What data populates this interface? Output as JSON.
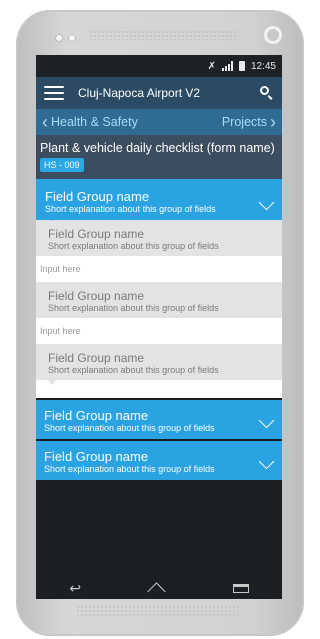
{
  "status": {
    "time": "12:45"
  },
  "appbar": {
    "title": "Cluj-Napoca Airport V2"
  },
  "subnav": {
    "back_label": "Health & Safety",
    "forward_label": "Projects"
  },
  "form": {
    "name": "Plant & vehicle daily checklist (form name)",
    "code": "HS - 009"
  },
  "groups": [
    {
      "title": "Field Group name",
      "subtitle": "Short explanation about this group of fields",
      "expanded": true,
      "items": [
        {
          "title": "Field Group name",
          "subtitle": "Short explanation about this group of fields",
          "input_placeholder": "Input here"
        },
        {
          "title": "Field Group name",
          "subtitle": "Short explanation about this group of fields",
          "input_placeholder": "Input here"
        },
        {
          "title": "Field Group name",
          "subtitle": "Short explanation about this group of fields"
        }
      ]
    },
    {
      "title": "Field Group name",
      "subtitle": "Short explanation about this group of fields",
      "expanded": false
    },
    {
      "title": "Field Group name",
      "subtitle": "Short explanation about this group of fields",
      "expanded": false
    }
  ],
  "colors": {
    "appbar": "#2b4a63",
    "subnav": "#2f6b93",
    "accent": "#2aa3e2",
    "formhead": "#3b4d5e"
  },
  "icons": [
    "menu-icon",
    "search-icon",
    "chevron-left-icon",
    "chevron-right-icon",
    "chevron-down-icon",
    "back-nav-icon",
    "home-nav-icon",
    "recent-apps-icon",
    "nfc-icon",
    "signal-icon",
    "battery-icon"
  ]
}
